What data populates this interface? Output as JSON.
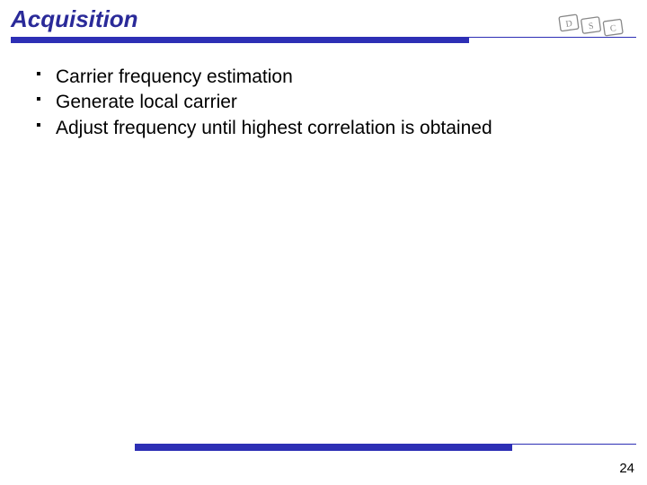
{
  "slide": {
    "title": "Acquisition",
    "bullets": [
      "Carrier frequency estimation",
      "Generate local carrier",
      "Adjust frequency until highest correlation is obtained"
    ],
    "page_number": "24",
    "logo_letters": [
      "D",
      "S",
      "C"
    ]
  },
  "colors": {
    "accent": "#2d2fb5",
    "title_color": "#2a2a99"
  }
}
